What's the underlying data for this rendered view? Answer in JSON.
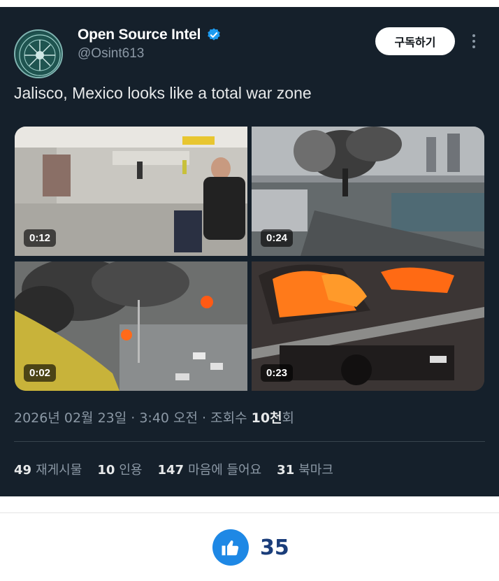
{
  "author": {
    "name": "Open Source Intel",
    "handle": "@Osint613"
  },
  "subscribe_label": "구독하기",
  "tweet_text": "Jalisco, Mexico looks like a total war zone",
  "media": [
    {
      "duration": "0:12"
    },
    {
      "duration": "0:24"
    },
    {
      "duration": "0:02"
    },
    {
      "duration": "0:23"
    }
  ],
  "meta": {
    "date_time": "2026년 02월 23일 · 3:40 오전 · 조회수 ",
    "views": "10천",
    "views_suffix": "회"
  },
  "stats": [
    {
      "count": "49",
      "label": "재게시물"
    },
    {
      "count": "10",
      "label": "인용"
    },
    {
      "count": "147",
      "label": "마음에 들어요"
    },
    {
      "count": "31",
      "label": "북마크"
    }
  ],
  "like": {
    "count": "35"
  },
  "colors": {
    "tweet_bg": "#15202b",
    "verified": "#1d9bf0",
    "like_button": "#1e88e5"
  }
}
